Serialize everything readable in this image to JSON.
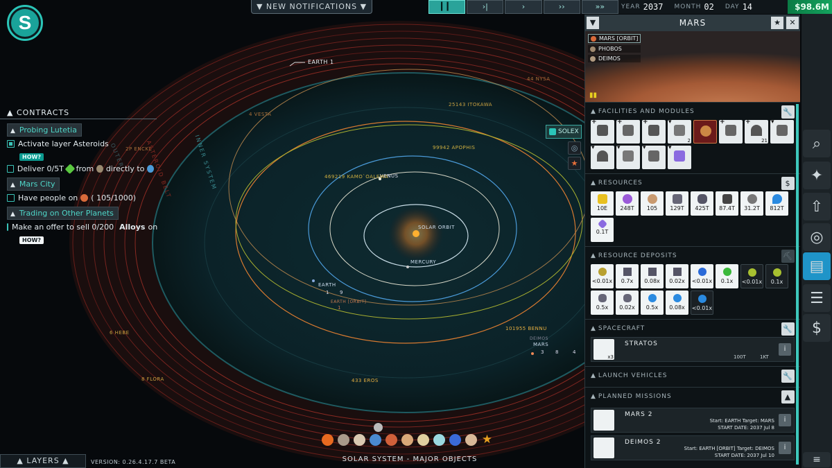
{
  "topbar": {
    "notifications": "▼ NEW NOTIFICATIONS ▼",
    "speed_buttons": [
      "▎▎",
      "›|",
      "›",
      "››",
      "»»"
    ],
    "year_label": "YEAR",
    "year": "2037",
    "month_label": "MONTH",
    "month": "02",
    "day_label": "DAY",
    "day": "14",
    "money": "$98.6M"
  },
  "logo": "S",
  "contracts": {
    "title": "CONTRACTS",
    "groups": [
      {
        "name": "Probing Lutetia",
        "tasks": [
          {
            "text": "Activate layer Asteroids",
            "done": true,
            "how": "HOW?"
          },
          {
            "text": "Deliver 0/5T",
            "mid": "from",
            "end": "directly to",
            "done": false
          }
        ]
      },
      {
        "name": "Mars City",
        "tasks": [
          {
            "text": "Have people on",
            "count": "( 105/1000)",
            "done": false
          }
        ]
      },
      {
        "name": "Trading on Other Planets",
        "tasks": [
          {
            "text": "Make an offer to sell 0/200",
            "bold": "Alloys",
            "end": "on",
            "done": false,
            "how": "HOW?"
          }
        ]
      }
    ]
  },
  "map": {
    "labels": {
      "earth1": "EARTH 1",
      "solar_orbit": "SOLAR ORBIT",
      "mercury": "MERCURY",
      "venus": "VENUS",
      "earth": "EARTH",
      "earth_orbit": "EARTH [ORBIT]",
      "mars": "MARS",
      "itokawa": "25143 ITOKAWA",
      "apophis": "99942 APOPHIS",
      "kamo": "469219 KAMO`OALEWA",
      "bennu": "101955 BENNU",
      "eros": "433 EROS",
      "hebe": "6 HEBE",
      "flora": "8 FLORA",
      "vesta": "4 VESTA",
      "encke": "2P ENCKE",
      "nysa": "44 NYSA",
      "deimos": "DEIMOS",
      "inner_system": "INNER SYSTEM",
      "asteroid_belt": "ASTEROID BELT",
      "outer": "OUTER"
    },
    "earth_stats": [
      "1",
      "9"
    ],
    "earth_orbit_stat": "1",
    "mars_stats": [
      "3",
      "8",
      "4"
    ]
  },
  "solex_btn": "SOLEX",
  "bottom": {
    "layers": "LAYERS ▲",
    "version": "VERSION: 0.26.4.17.7 BETA",
    "title": "SOLAR SYSTEM - MAJOR OBJECTS"
  },
  "panel": {
    "title": "MARS",
    "moons": [
      "MARS [ORBIT]",
      "PHOBOS",
      "DEIMOS"
    ],
    "facilities_title": "FACILITIES AND MODULES",
    "resources_title": "RESOURCES",
    "resources": [
      "10E",
      "248T",
      "105",
      "129T",
      "425T",
      "87.4T",
      "31.2T",
      "812T",
      "0.1T"
    ],
    "deposits_title": "RESOURCE DEPOSITS",
    "deposits": [
      "<0.01x",
      "0.7x",
      "0.08x",
      "0.02x",
      "<0.01x",
      "0.1x",
      "<0.01x",
      "0.1x",
      "0.5x",
      "0.02x",
      "0.5x",
      "0.08x",
      "<0.01x"
    ],
    "spacecraft_title": "SPACECRAFT",
    "ship": {
      "name": "STRATOS",
      "count": "x3",
      "stat1": "100T",
      "stat2": "1KT"
    },
    "launch_title": "LAUNCH VEHICLES",
    "missions_title": "PLANNED MISSIONS",
    "missions": [
      {
        "name": "MARS 2",
        "route": "Start: EARTH Target: MARS",
        "date": "START DATE: 2037 Jul 8"
      },
      {
        "name": "DEIMOS 2",
        "route": "Start: EARTH [ORBIT] Target: DEIMOS",
        "date": "START DATE: 2037 Jul 10"
      }
    ],
    "facility_counts": [
      "2",
      "21"
    ]
  },
  "colors": {
    "accent": "#2bc5b8",
    "money": "#14a35e",
    "nav_active": "#1f94c8"
  },
  "icons": [
    "search-icon",
    "satellite-icon",
    "rocket-icon",
    "orbit-icon",
    "panels-icon",
    "document-icon",
    "finance-icon",
    "menu-icon"
  ]
}
